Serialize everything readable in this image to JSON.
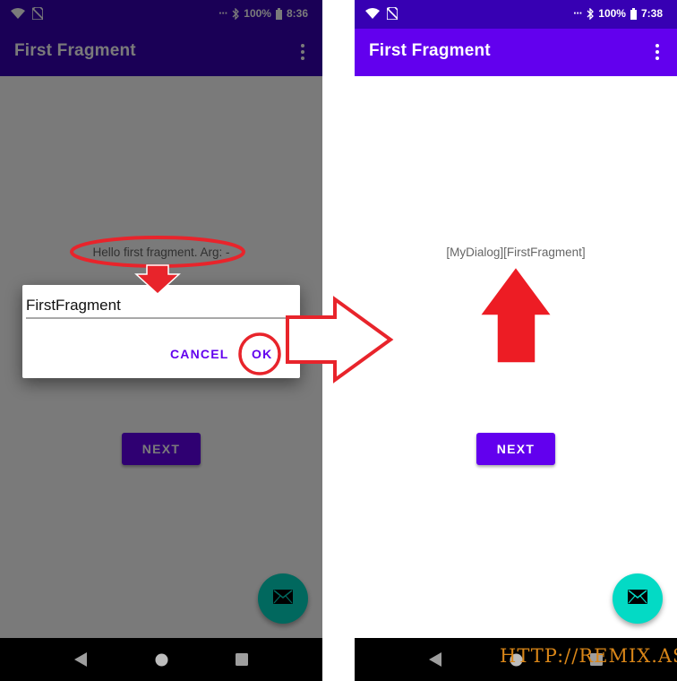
{
  "left_screen": {
    "status": {
      "battery": "100%",
      "time": "8:36"
    },
    "app_title": "First Fragment",
    "message": "Hello first fragment. Arg: -",
    "next_label": "NEXT",
    "dialog": {
      "input_value": "FirstFragment",
      "cancel_label": "CANCEL",
      "ok_label": "OK"
    },
    "colors": {
      "toolbar": "#3700b3",
      "scrim": "rgba(0,0,0,0.52)"
    }
  },
  "right_screen": {
    "status": {
      "battery": "100%",
      "time": "7:38"
    },
    "app_title": "First Fragment",
    "message": "[MyDialog][FirstFragment]",
    "next_label": "NEXT",
    "colors": {
      "primary": "#6200ee",
      "primary_dark": "#3700b3",
      "fab": "#03dac5"
    }
  },
  "icons": [
    "wifi-icon",
    "no-sim-icon",
    "bluetooth-icon",
    "battery-icon",
    "overflow-menu-icon",
    "mail-icon",
    "back-icon",
    "home-icon",
    "recents-icon"
  ],
  "annotation_colors": {
    "highlight": "#e8242b"
  },
  "watermark": "HTTP://REMIX.ASIA"
}
